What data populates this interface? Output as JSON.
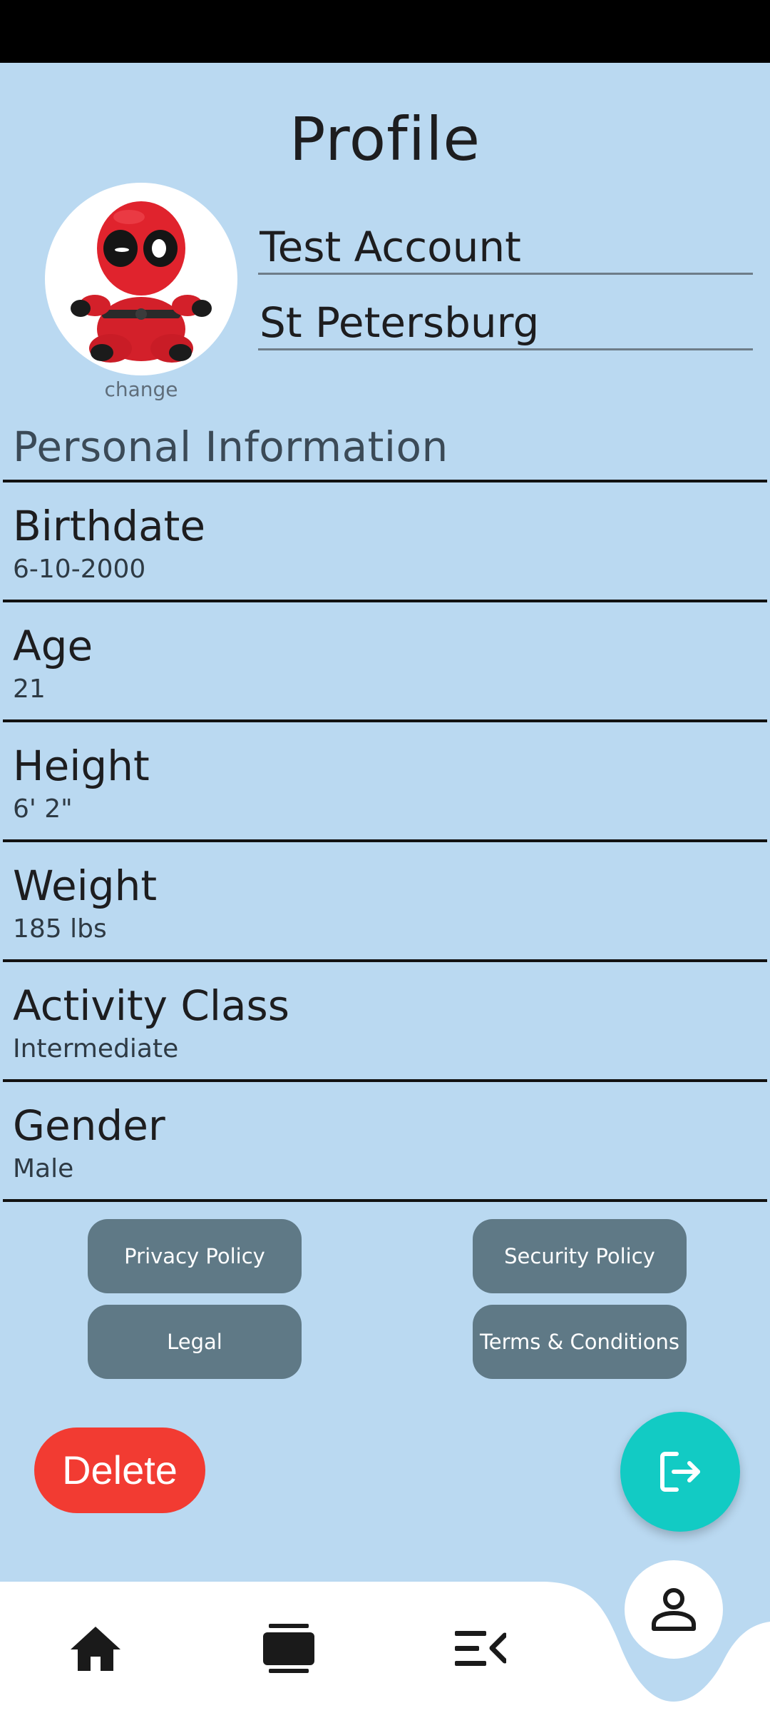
{
  "header": {
    "title": "Profile"
  },
  "profile": {
    "change_label": "change",
    "name": "Test Account",
    "city": "St Petersburg"
  },
  "personal_info": {
    "heading": "Personal Information",
    "rows": [
      {
        "label": "Birthdate",
        "value": "6-10-2000"
      },
      {
        "label": "Age",
        "value": "21"
      },
      {
        "label": "Height",
        "value": "6' 2\""
      },
      {
        "label": "Weight",
        "value": "185 lbs"
      },
      {
        "label": "Activity Class",
        "value": "Intermediate"
      },
      {
        "label": "Gender",
        "value": "Male"
      }
    ]
  },
  "links": {
    "privacy": "Privacy Policy",
    "security": "Security Policy",
    "legal": "Legal",
    "terms": "Terms & Conditions"
  },
  "actions": {
    "delete_label": "Delete",
    "logout_icon": "logout-icon"
  },
  "nav": {
    "items": [
      {
        "icon": "home-icon"
      },
      {
        "icon": "card-icon"
      },
      {
        "icon": "menu-collapse-icon"
      },
      {
        "icon": "person-icon"
      }
    ]
  },
  "colors": {
    "background": "#bad9f1",
    "pill_button": "#5f7986",
    "delete": "#f23b32",
    "fab": "#12cbc4"
  }
}
